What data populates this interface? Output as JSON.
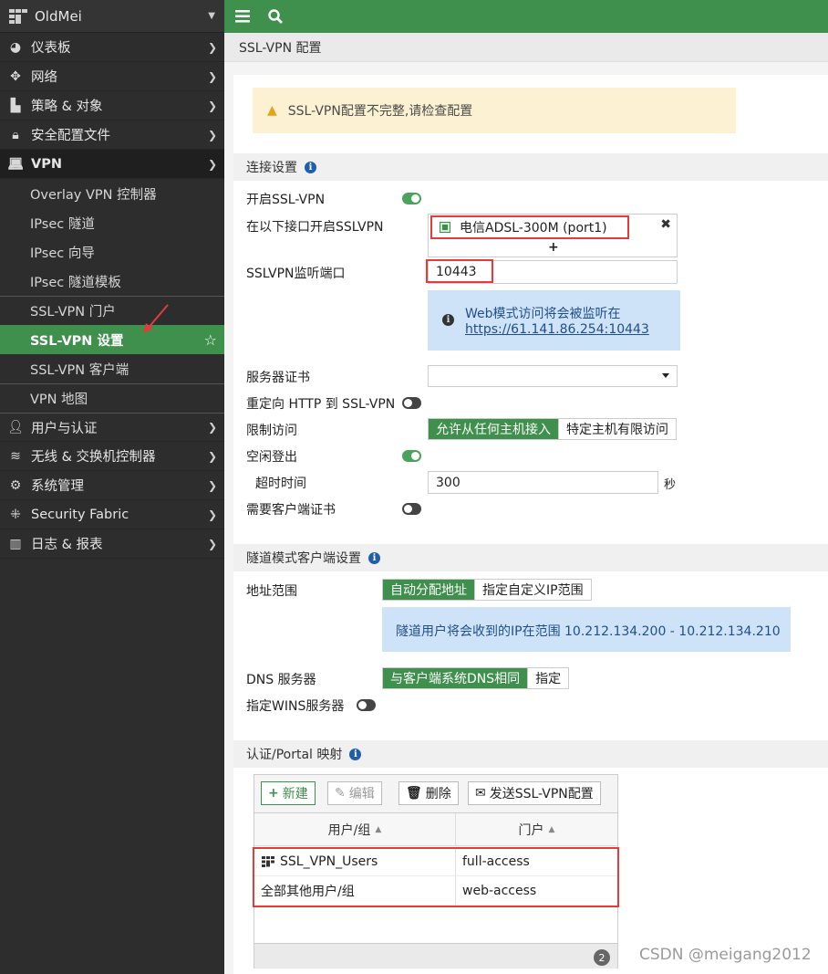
{
  "brand": {
    "name": "OldMei"
  },
  "sidebar": {
    "items": [
      {
        "label": "仪表板"
      },
      {
        "label": "网络"
      },
      {
        "label": "策略 & 对象"
      },
      {
        "label": "安全配置文件"
      },
      {
        "label": "VPN"
      },
      {
        "label": "用户与认证"
      },
      {
        "label": "无线 & 交换机控制器"
      },
      {
        "label": "系统管理"
      },
      {
        "label": "Security Fabric"
      },
      {
        "label": "日志 & 报表"
      }
    ],
    "vpn_sub": [
      {
        "label": "Overlay VPN 控制器"
      },
      {
        "label": "IPsec 隧道"
      },
      {
        "label": "IPsec 向导"
      },
      {
        "label": "IPsec 隧道模板"
      },
      {
        "label": "SSL-VPN 门户"
      },
      {
        "label": "SSL-VPN 设置"
      },
      {
        "label": "SSL-VPN 客户端"
      },
      {
        "label": "VPN 地图"
      }
    ]
  },
  "page": {
    "title": "SSL-VPN 配置"
  },
  "warning": {
    "text": "SSL-VPN配置不完整,请检查配置"
  },
  "conn": {
    "header": "连接设置",
    "enable_label": "开启SSL-VPN",
    "iface_label": "在以下接口开启SSLVPN",
    "iface_value": "电信ADSL-300M (port1)",
    "port_label": "SSLVPN监听端口",
    "port_value": "10443",
    "web_info": "Web模式访问将会被监听在",
    "web_url": "https://61.141.86.254:10443",
    "cert_label": "服务器证书",
    "redirect_label": "重定向 HTTP 到 SSL-VPN",
    "restrict_label": "限制访问",
    "restrict_opt1": "允许从任何主机接入",
    "restrict_opt2": "特定主机有限访问",
    "idle_label": "空闲登出",
    "timeout_label": "超时时间",
    "timeout_value": "300",
    "timeout_unit": "秒",
    "client_cert_label": "需要客户端证书"
  },
  "tunnel": {
    "header": "隧道模式客户端设置",
    "range_label": "地址范围",
    "range_opt1": "自动分配地址",
    "range_opt2": "指定自定义IP范围",
    "range_info": "隧道用户将会收到的IP在范围 10.212.134.200 - 10.212.134.210",
    "dns_label": "DNS 服务器",
    "dns_opt1": "与客户端系统DNS相同",
    "dns_opt2": "指定",
    "wins_label": "指定WINS服务器"
  },
  "auth": {
    "header": "认证/Portal 映射",
    "btn_new": "新建",
    "btn_edit": "编辑",
    "btn_delete": "删除",
    "btn_send": "发送SSL-VPN配置",
    "col_user": "用户/组",
    "col_portal": "门户",
    "rows": [
      {
        "user": "SSL_VPN_Users",
        "portal": "full-access"
      },
      {
        "user": "全部其他用户/组",
        "portal": "web-access"
      }
    ],
    "count": "2"
  },
  "watermark": "CSDN @meigang2012"
}
